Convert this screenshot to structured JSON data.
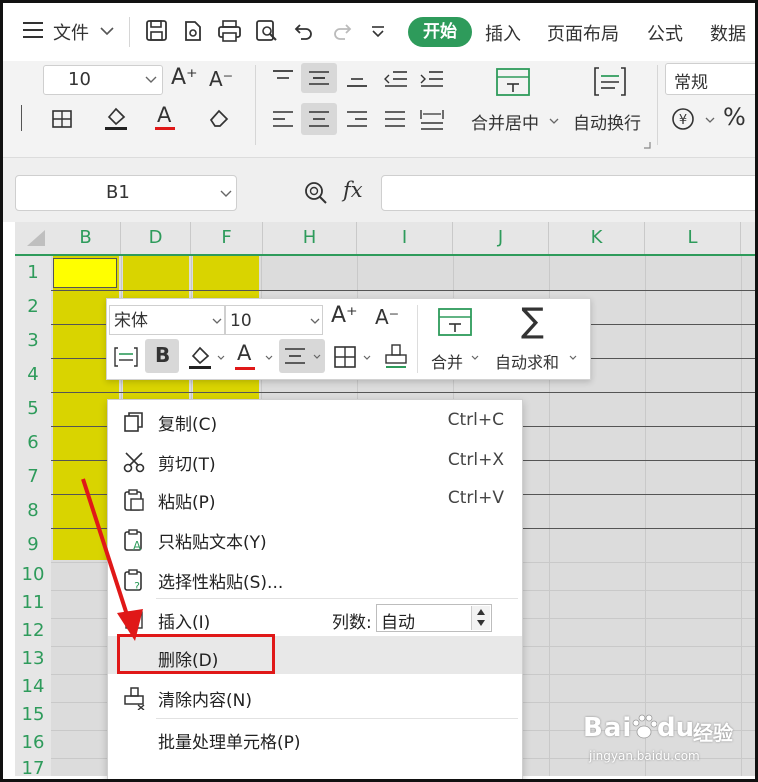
{
  "menubar": {
    "menu_icon": "hamburger-icon",
    "file_label": "文件",
    "tabs": [
      "开始",
      "插入",
      "页面布局",
      "公式",
      "数据"
    ],
    "active_tab": "开始"
  },
  "ribbon": {
    "font_size": "10",
    "merge_center_label": "合并居中",
    "wrap_text_label": "自动换行",
    "number_format": "常规",
    "percent_symbol": "%"
  },
  "formula_bar": {
    "name_box": "B1",
    "fx_label": "fx",
    "formula_value": ""
  },
  "grid": {
    "columns": [
      "B",
      "D",
      "F",
      "H",
      "I",
      "J",
      "K",
      "L"
    ],
    "rows": [
      "1",
      "2",
      "3",
      "4",
      "5",
      "6",
      "7",
      "8",
      "9",
      "10",
      "11",
      "12",
      "13",
      "14",
      "15",
      "16",
      "17"
    ],
    "selection_color": "#d9d400"
  },
  "mini_toolbar": {
    "font_name": "宋体",
    "font_size": "10",
    "bold_label": "B",
    "merge_label": "合并",
    "autosum_label": "自动求和",
    "sigma_symbol": "∑"
  },
  "context_menu": {
    "items": [
      {
        "label": "复制(C)",
        "shortcut": "Ctrl+C",
        "icon": "copy-icon"
      },
      {
        "label": "剪切(T)",
        "shortcut": "Ctrl+X",
        "icon": "scissors-icon"
      },
      {
        "label": "粘贴(P)",
        "shortcut": "Ctrl+V",
        "icon": "paste-icon"
      },
      {
        "label": "只粘贴文本(Y)",
        "shortcut": "",
        "icon": "paste-text-icon"
      },
      {
        "label": "选择性粘贴(S)...",
        "shortcut": "",
        "icon": "paste-special-icon"
      },
      {
        "label": "插入(I)",
        "shortcut": "",
        "icon": "insert-icon"
      },
      {
        "label": "删除(D)",
        "shortcut": "",
        "icon": ""
      },
      {
        "label": "清除内容(N)",
        "shortcut": "",
        "icon": "eraser-icon"
      },
      {
        "label": "批量处理单元格(P)",
        "shortcut": "",
        "icon": ""
      }
    ],
    "insert_count_label": "列数:",
    "insert_count_value": "自动",
    "highlighted_item": "删除(D)"
  },
  "annotation": {
    "arrow_color": "#e01818",
    "box_color": "#e01818"
  },
  "watermark": {
    "brand": "Bai",
    "brand_suffix": "du",
    "cn": "经验",
    "url": "jingyan.baidu.com"
  }
}
